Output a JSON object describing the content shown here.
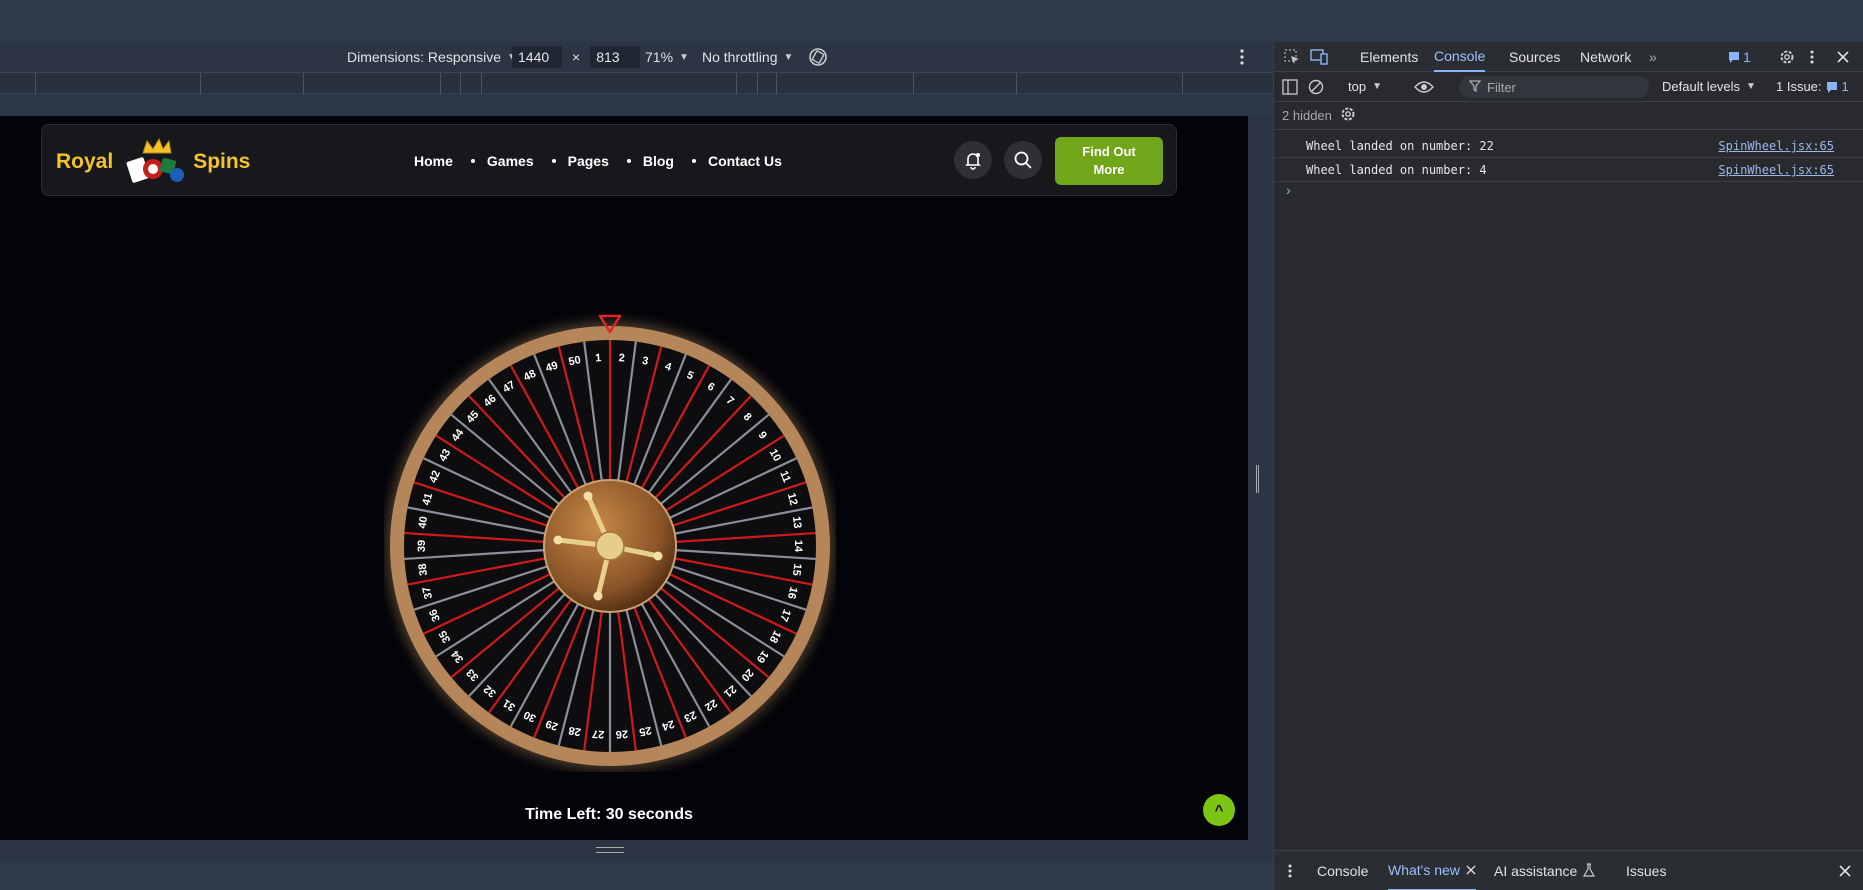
{
  "device_toolbar": {
    "dimensions_label": "Dimensions: Responsive",
    "width_value": "1440",
    "times": "×",
    "height_value": "813",
    "zoom": "71%",
    "throttling": "No throttling"
  },
  "site": {
    "logo_left": "Royal",
    "logo_right": "Spins",
    "nav": [
      "Home",
      "Games",
      "Pages",
      "Blog",
      "Contact Us"
    ],
    "cta_label": "Find Out More",
    "time_left": "Time Left: 30 seconds",
    "scroll_top_label": "^"
  },
  "wheel": {
    "numbers": [
      "1",
      "2",
      "3",
      "4",
      "5",
      "6",
      "7",
      "8",
      "9",
      "10",
      "11",
      "12",
      "13",
      "14",
      "15",
      "16",
      "17",
      "18",
      "19",
      "20",
      "21",
      "22",
      "23",
      "24",
      "25",
      "26",
      "27",
      "28",
      "29",
      "30",
      "31",
      "32",
      "33",
      "34",
      "35",
      "36",
      "37",
      "38",
      "39",
      "40",
      "41",
      "42",
      "43",
      "44",
      "45",
      "46",
      "47",
      "48",
      "49",
      "50"
    ],
    "colors": {
      "red": "#d01a1a",
      "grey": "#8a8f99",
      "rim": "#b5865a",
      "hub": "#8a5428"
    }
  },
  "devtools": {
    "tabs": [
      "Elements",
      "Console",
      "Sources",
      "Network"
    ],
    "active_tab": "Console",
    "issue_badge": "1",
    "context": "top",
    "filter_placeholder": "Filter",
    "levels": "Default levels",
    "issues_label": "1 Issue:",
    "issues_count": "1",
    "hidden_label": "2 hidden",
    "logs": [
      {
        "message": "Wheel landed on number: 22",
        "source": "SpinWheel.jsx:65"
      },
      {
        "message": "Wheel landed on number: 4",
        "source": "SpinWheel.jsx:65"
      }
    ],
    "prompt": "›",
    "drawer_tabs": [
      "Console",
      "What's new",
      "AI assistance",
      "Issues"
    ]
  }
}
